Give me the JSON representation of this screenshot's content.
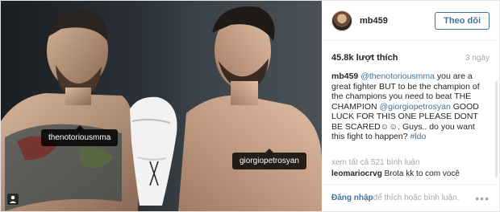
{
  "post": {
    "tags": {
      "left": "thenotoriousmma",
      "right": "giorgiopetrosyan"
    }
  },
  "header": {
    "username": "mb459",
    "follow_label": "Theo dõi"
  },
  "stats": {
    "likes": "45.8k lượt thích",
    "time": "3 ngày"
  },
  "caption": {
    "user": "mb459",
    "mention1": "@thenotoriousmma",
    "text1": " you are a great fighter BUT to be the champion of the champions you need to beat THE CHAMPION ",
    "mention2": "@giorgiopetrosyan",
    "text2": " GOOD LUCK FOR THIS ONE PLEASE DONT BE SCARED☺☺. Guys.. do you want this fight to happen? ",
    "hashtag": "#ldo"
  },
  "comments": {
    "view_all": "xem tất cả 521 bình luận",
    "items": [
      {
        "user": "leomariocrvg",
        "text": " Brota kk to com você"
      }
    ]
  },
  "footer": {
    "login": "Đăng nhập",
    "rest": " để thích hoặc bình luận.",
    "more": "•••"
  },
  "colors": {
    "link": "#3f729b",
    "muted": "#a5a7aa",
    "text": "#262626"
  }
}
